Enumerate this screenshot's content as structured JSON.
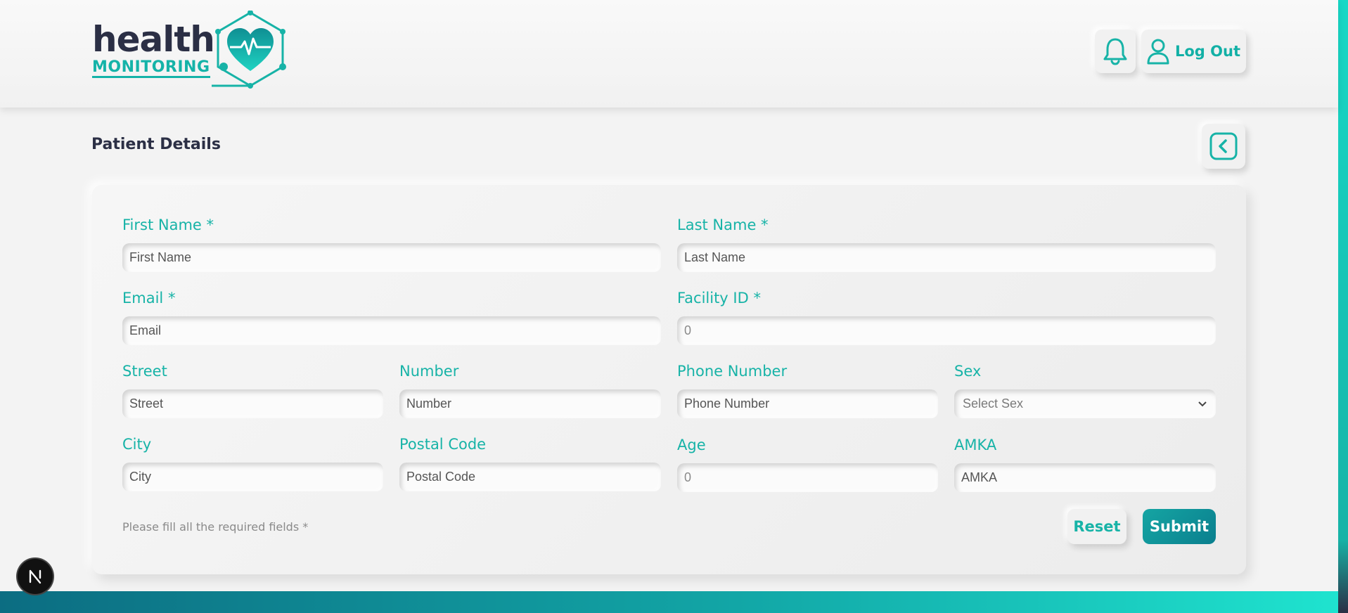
{
  "header": {
    "logo": {
      "word1": "health",
      "word2": "MONITORING"
    },
    "logout_label": "Log Out"
  },
  "page": {
    "title": "Patient Details"
  },
  "form": {
    "first_name": {
      "label": "First Name *",
      "placeholder": "First Name"
    },
    "last_name": {
      "label": "Last Name *",
      "placeholder": "Last Name"
    },
    "email": {
      "label": "Email *",
      "placeholder": "Email"
    },
    "facility_id": {
      "label": "Facility ID *",
      "placeholder": "0"
    },
    "street": {
      "label": "Street",
      "placeholder": "Street"
    },
    "number": {
      "label": "Number",
      "placeholder": "Number"
    },
    "phone": {
      "label": "Phone Number",
      "placeholder": "Phone Number"
    },
    "sex": {
      "label": "Sex",
      "selected": "Select Sex"
    },
    "city": {
      "label": "City",
      "placeholder": "City"
    },
    "postal_code": {
      "label": "Postal Code",
      "placeholder": "Postal Code"
    },
    "age": {
      "label": "Age",
      "placeholder": "0"
    },
    "amka": {
      "label": "AMKA",
      "placeholder": "AMKA"
    },
    "required_note": "Please fill all the required fields *",
    "reset_label": "Reset",
    "submit_label": "Submit"
  },
  "colors": {
    "accent": "#17b3a7",
    "dark_text": "#2b2f45",
    "submit_bg": "#0a7f8e"
  },
  "icons": {
    "notification": "bell-icon",
    "user": "user-icon",
    "back": "chevron-left-icon",
    "sex_dropdown": "chevron-down-icon",
    "dev_badge": "next-badge-icon"
  }
}
